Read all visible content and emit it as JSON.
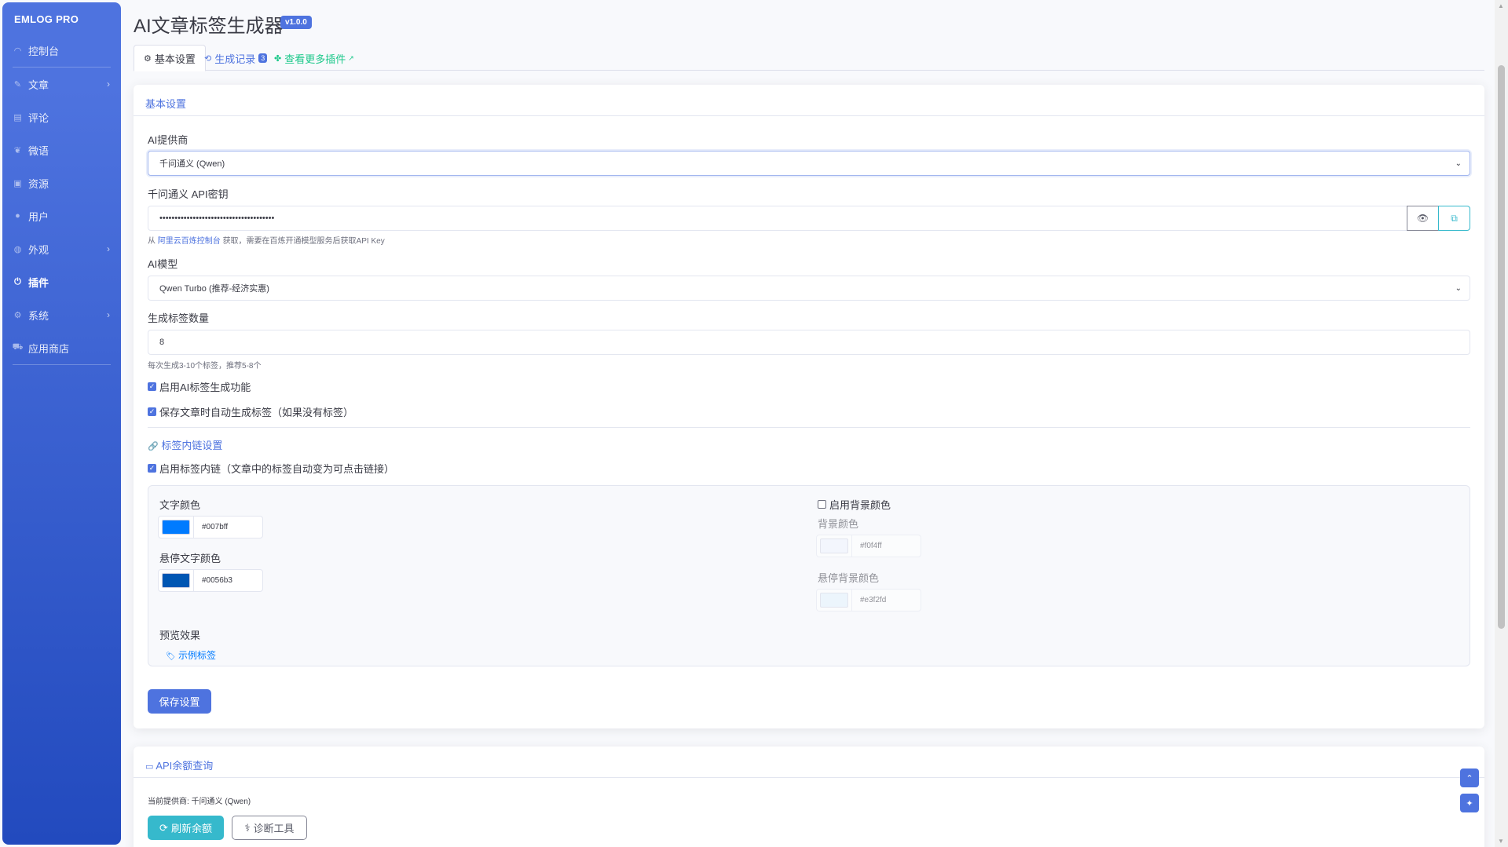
{
  "brand": "EMLOG PRO",
  "sidebar": {
    "items": [
      {
        "label": "控制台",
        "icon": "dashboard-icon",
        "chevron": false,
        "active": false
      },
      {
        "label": "文章",
        "icon": "pencil-icon",
        "chevron": true,
        "active": false
      },
      {
        "label": "评论",
        "icon": "comment-icon",
        "chevron": false,
        "active": false
      },
      {
        "label": "微语",
        "icon": "twitter-icon",
        "chevron": false,
        "active": false
      },
      {
        "label": "资源",
        "icon": "image-icon",
        "chevron": false,
        "active": false
      },
      {
        "label": "用户",
        "icon": "user-icon",
        "chevron": false,
        "active": false
      },
      {
        "label": "外观",
        "icon": "palette-icon",
        "chevron": true,
        "active": false
      },
      {
        "label": "插件",
        "icon": "plug-icon",
        "chevron": false,
        "active": true
      },
      {
        "label": "系统",
        "icon": "gear-icon",
        "chevron": true,
        "active": false
      },
      {
        "label": "应用商店",
        "icon": "cart-icon",
        "chevron": false,
        "active": false
      }
    ]
  },
  "header": {
    "title": "AI文章标签生成器",
    "version": "v1.0.0"
  },
  "tabs": {
    "basic": "基本设置",
    "history": "生成记录",
    "history_count": "3",
    "more": "查看更多插件"
  },
  "settings": {
    "card_title": "基本设置",
    "provider_label": "AI提供商",
    "provider_value": "千问通义 (Qwen)",
    "api_key_label": "千问通义 API密钥",
    "api_key_value": "••••••••••••••••••••••••••••••••••••••",
    "api_help_prefix": "从",
    "api_help_link": "阿里云百炼控制台",
    "api_help_suffix": "获取，需要在百炼开通模型服务后获取API Key",
    "model_label": "AI模型",
    "model_value": "Qwen Turbo (推荐-经济实惠)",
    "count_label": "生成标签数量",
    "count_value": "8",
    "count_help": "每次生成3-10个标签，推荐5-8个",
    "enable_ai": "启用AI标签生成功能",
    "auto_generate": "保存文章时自动生成标签（如果没有标签）",
    "link_section_title": "标签内链设置",
    "enable_link": "启用标签内链（文章中的标签自动变为可点击链接）",
    "text_color_label": "文字颜色",
    "text_color": "#007bff",
    "hover_text_color_label": "悬停文字颜色",
    "hover_text_color": "#0056b3",
    "enable_bg_label": "启用背景颜色",
    "bg_color_label": "背景颜色",
    "bg_color": "#f0f4ff",
    "hover_bg_color_label": "悬停背景颜色",
    "hover_bg_color": "#e3f2fd",
    "preview_label": "预览效果",
    "preview_tag": "示例标签",
    "save_button": "保存设置"
  },
  "balance": {
    "card_title": "API余额查询",
    "current_provider": "当前提供商: 千问通义 (Qwen)",
    "refresh_button": "刷新余额",
    "diagnose_button": "诊断工具"
  },
  "colors": {
    "primary": "#4e73df",
    "success": "#1cc88a",
    "info": "#36b9cc"
  }
}
